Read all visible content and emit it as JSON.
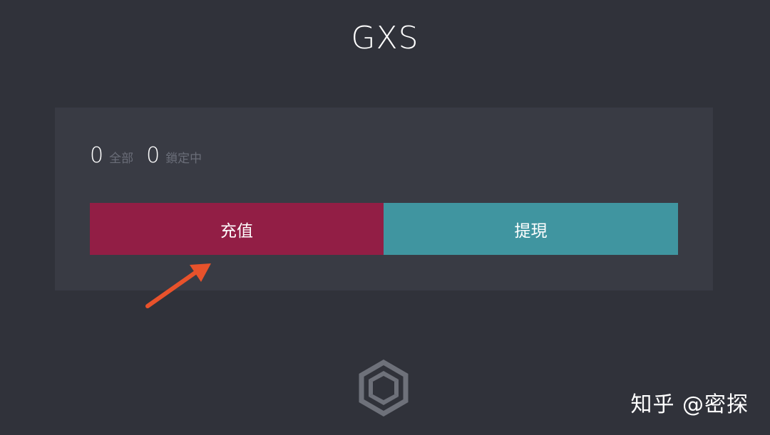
{
  "header": {
    "title": "GXS"
  },
  "balances": {
    "total_value": "0",
    "total_label": "全部",
    "locked_value": "0",
    "locked_label": "鎖定中"
  },
  "actions": {
    "deposit_label": "充值",
    "withdraw_label": "提現"
  },
  "colors": {
    "background": "#30323a",
    "panel": "#393b44",
    "deposit_button": "#921e45",
    "withdraw_button": "#4095a0",
    "annotation_arrow": "#e8522b"
  },
  "icons": {
    "logo": "gxs-logo-icon",
    "annotation": "arrow-icon"
  },
  "watermark": {
    "text": "知乎 @密探"
  }
}
